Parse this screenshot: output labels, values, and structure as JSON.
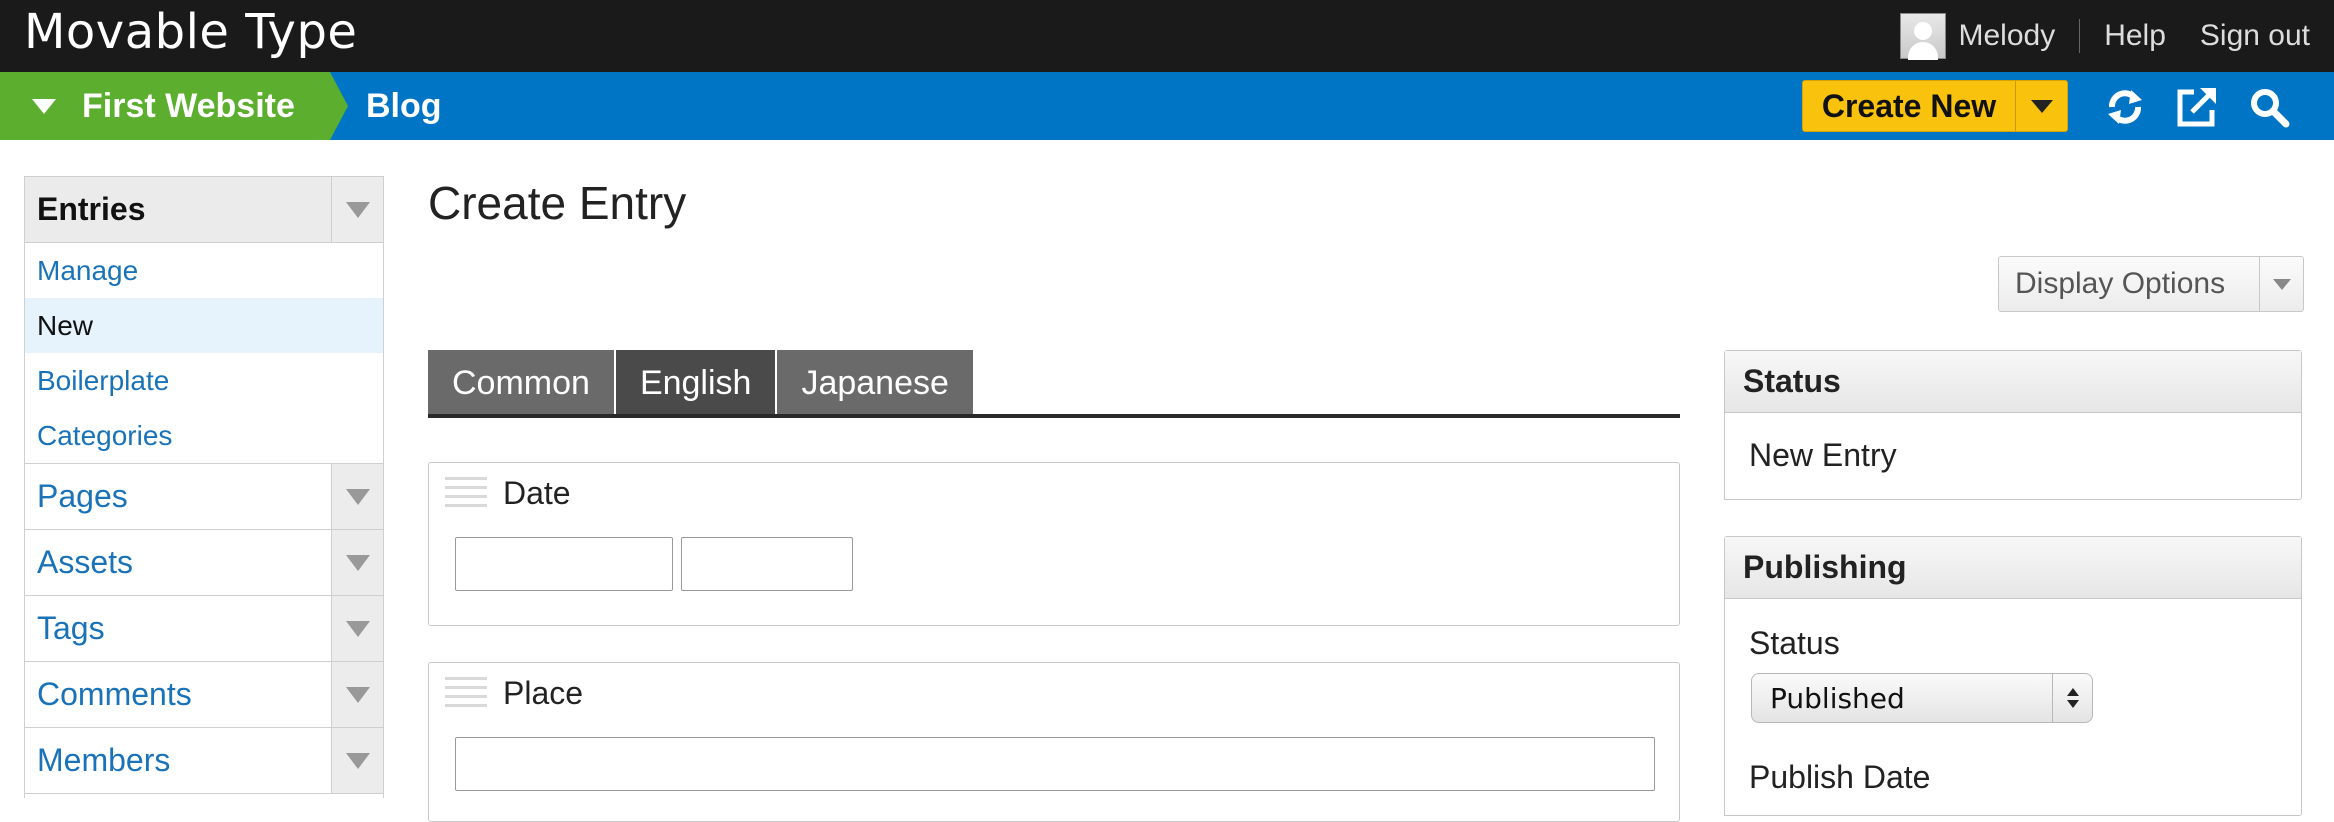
{
  "app": {
    "brand": "Movable Type",
    "user": {
      "name": "Melody",
      "help": "Help",
      "signout": "Sign out"
    }
  },
  "context": {
    "website": "First Website",
    "blog": "Blog",
    "create_new": "Create New"
  },
  "sidebar": {
    "entries": {
      "label": "Entries",
      "items": [
        "Manage",
        "New",
        "Boilerplate",
        "Categories"
      ]
    },
    "sections": [
      "Pages",
      "Assets",
      "Tags",
      "Comments",
      "Members"
    ]
  },
  "main": {
    "title": "Create Entry",
    "display_options": "Display Options",
    "tabs": [
      "Common",
      "English",
      "Japanese"
    ],
    "fields": {
      "date": {
        "label": "Date",
        "date_value": "",
        "time_value": ""
      },
      "place": {
        "label": "Place",
        "value": ""
      }
    }
  },
  "status_panel": {
    "title": "Status",
    "value": "New Entry"
  },
  "publishing_panel": {
    "title": "Publishing",
    "status_label": "Status",
    "status_value": "Published",
    "publish_date_label": "Publish Date"
  },
  "colors": {
    "green": "#5cae2f",
    "blue": "#0074c5",
    "yellow": "#f8c20d",
    "link": "#1a73b8"
  }
}
